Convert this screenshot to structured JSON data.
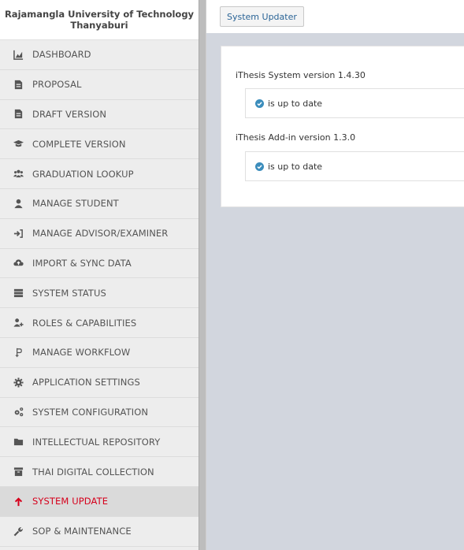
{
  "sidebar": {
    "brand_line1": "Rajamangla University of Technology",
    "brand_line2": "Thanyaburi",
    "items": [
      {
        "label": "DASHBOARD",
        "icon": "chart-icon"
      },
      {
        "label": "PROPOSAL",
        "icon": "document-icon"
      },
      {
        "label": "DRAFT VERSION",
        "icon": "document-icon"
      },
      {
        "label": "COMPLETE VERSION",
        "icon": "graduation-cap-icon"
      },
      {
        "label": "GRADUATION LOOKUP",
        "icon": "users-icon"
      },
      {
        "label": "MANAGE STUDENT",
        "icon": "user-icon"
      },
      {
        "label": "MANAGE ADVISOR/EXAMINER",
        "icon": "sign-in-icon"
      },
      {
        "label": "IMPORT & SYNC DATA",
        "icon": "cloud-upload-icon"
      },
      {
        "label": "SYSTEM STATUS",
        "icon": "server-icon"
      },
      {
        "label": "ROLES & CAPABILITIES",
        "icon": "user-plus-icon"
      },
      {
        "label": "MANAGE WORKFLOW",
        "icon": "workflow-icon"
      },
      {
        "label": "APPLICATION SETTINGS",
        "icon": "gear-icon"
      },
      {
        "label": "SYSTEM CONFIGURATION",
        "icon": "gears-icon"
      },
      {
        "label": "INTELLECTUAL REPOSITORY",
        "icon": "folder-icon"
      },
      {
        "label": "THAI DIGITAL COLLECTION",
        "icon": "archive-icon"
      },
      {
        "label": "SYSTEM UPDATE",
        "icon": "arrow-up-icon"
      },
      {
        "label": "SOP & MAINTENANCE",
        "icon": "wrench-icon"
      }
    ],
    "active_index": 15
  },
  "header": {
    "tab_label": "System Updater"
  },
  "updates": [
    {
      "title": "iThesis System version 1.4.30",
      "status": "is up to date"
    },
    {
      "title": "iThesis Add-in version 1.3.0",
      "status": "is up to date"
    }
  ],
  "colors": {
    "accent": "#d6001c",
    "link": "#2a6496",
    "check": "#3c8dbc"
  }
}
